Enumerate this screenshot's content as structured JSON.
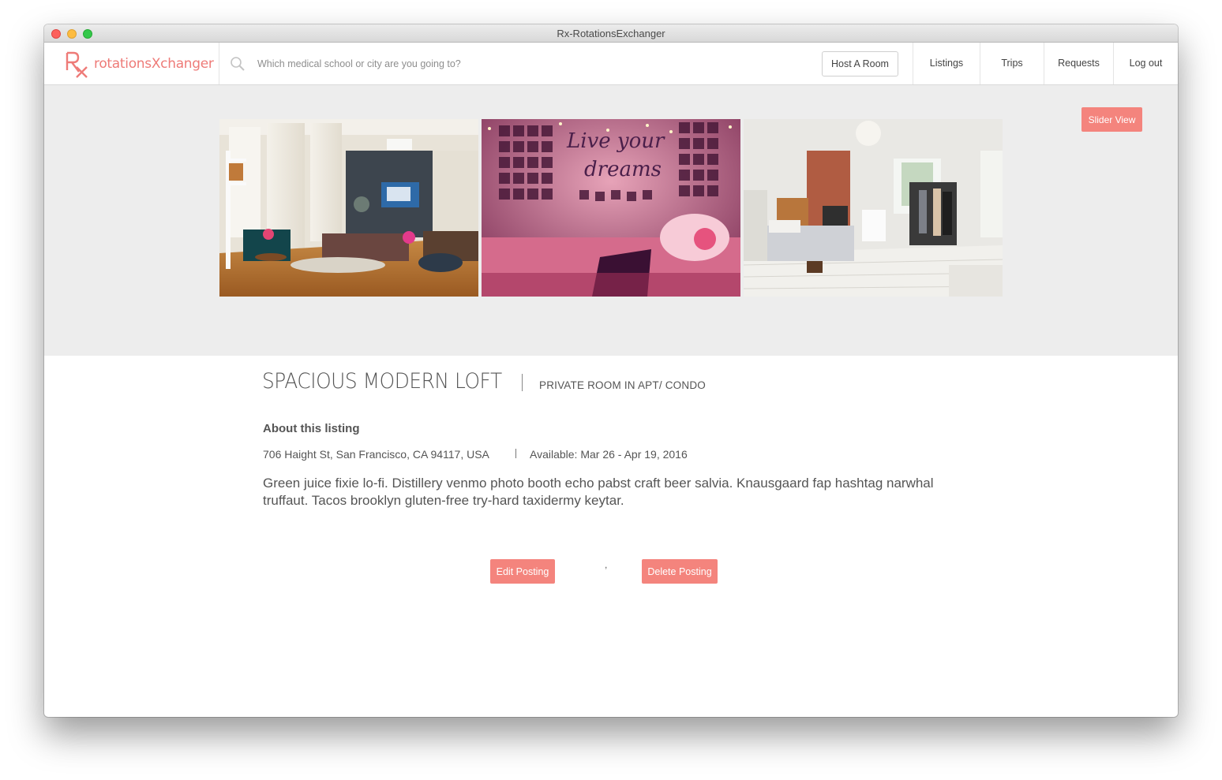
{
  "window": {
    "title": "Rx-RotationsExchanger"
  },
  "navbar": {
    "logo_text": "rotationsXchanger",
    "search_placeholder": "Which medical school or city are you going to?",
    "host_label": "Host A Room",
    "links": [
      "Listings",
      "Trips",
      "Requests",
      "Log out"
    ]
  },
  "hero": {
    "slider_label": "Slider View",
    "photos": [
      "living room loft",
      "dorm bedroom with 'Live your dreams' wall",
      "white bedroom with clothing rack"
    ],
    "photo2_text_line1": "Live your",
    "photo2_text_line2": "dreams"
  },
  "listing": {
    "title": "SPACIOUS MODERN LOFT",
    "room_type": "PRIVATE ROOM IN APT/ CONDO",
    "about_heading": "About this listing",
    "address": "706 Haight St, San Francisco, CA 94117, USA",
    "available": "Available: Mar 26 - Apr 19, 2016",
    "description": "Green juice fixie lo-fi. Distillery venmo photo booth echo pabst craft beer salvia. Knausgaard fap hashtag narwhal truffaut. Tacos brooklyn gluten-free try-hard taxidermy keytar."
  },
  "actions": {
    "edit_label": "Edit Posting",
    "separator": ",",
    "delete_label": "Delete Posting"
  },
  "colors": {
    "accent": "#f4847d",
    "logo": "#ee7b78",
    "hero_bg": "#ededed"
  },
  "icons": [
    "search-icon",
    "rx-logo-icon"
  ]
}
